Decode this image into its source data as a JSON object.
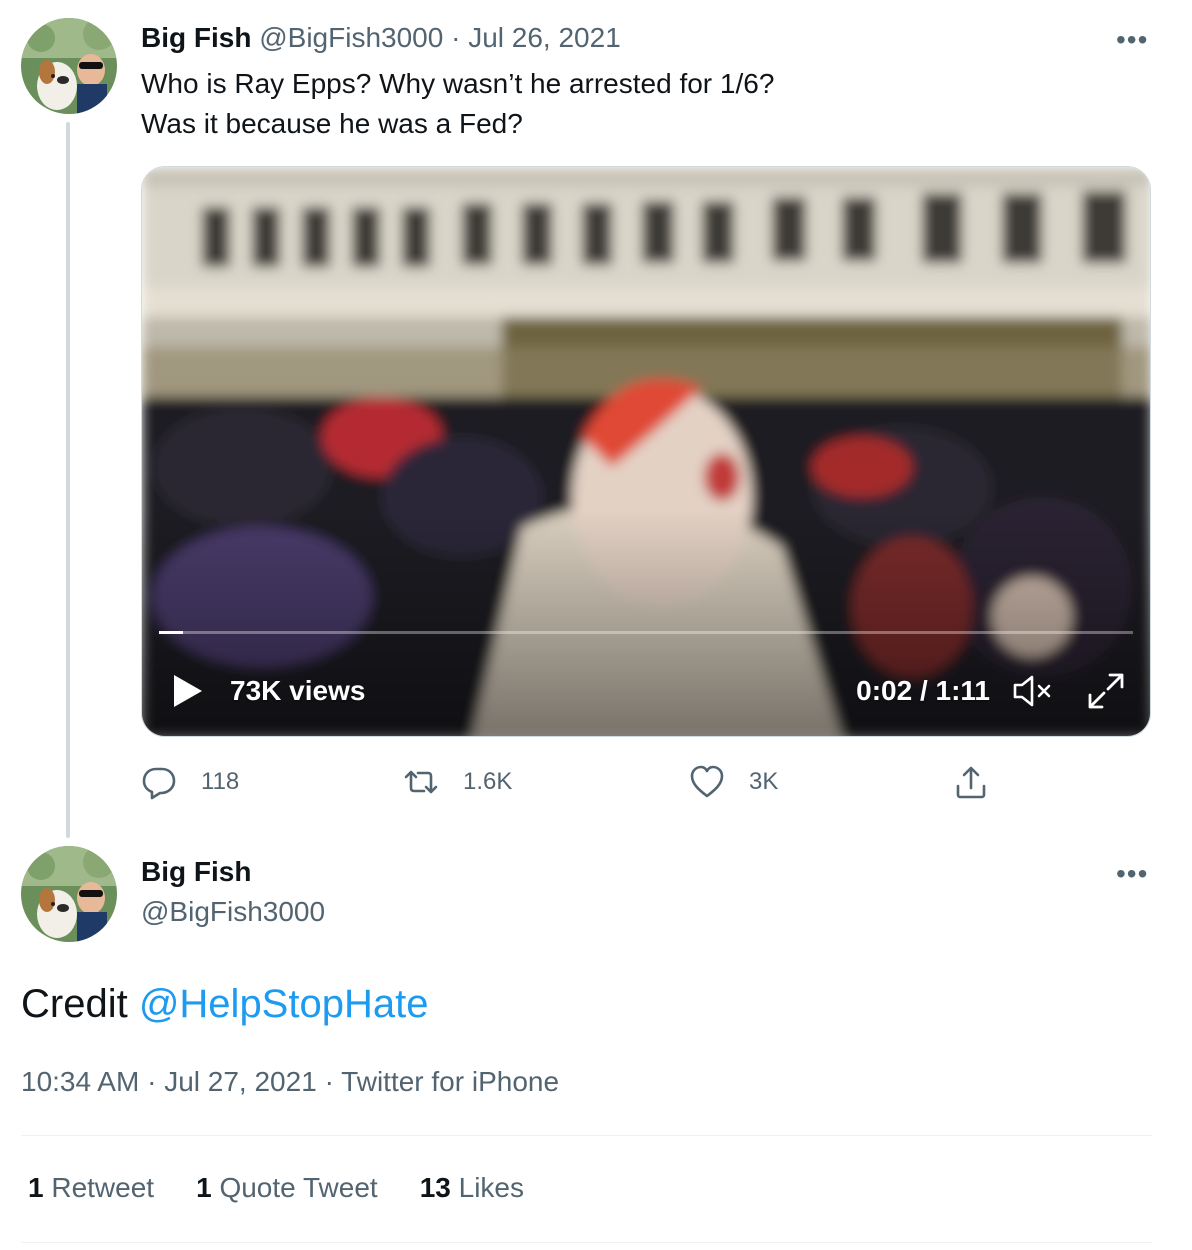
{
  "thread": {
    "tweet1": {
      "display_name": "Big Fish",
      "handle": "@BigFish3000",
      "separator": "·",
      "date": "Jul 26, 2021",
      "text_line1": "Who is Ray Epps? Why wasn’t he arrested for 1/6?",
      "text_line2": "Was it because he was a Fed?",
      "more_icon": "more-horizontal-icon",
      "video": {
        "views": "73K views",
        "timecode": "0:02 / 1:11",
        "progress": 0.025,
        "icons": [
          "play-icon",
          "mute-icon",
          "fullscreen-icon"
        ]
      },
      "actions": {
        "reply_count": "118",
        "retweet_count": "1.6K",
        "like_count": "3K"
      }
    },
    "tweet2": {
      "display_name": "Big Fish",
      "handle": "@BigFish3000",
      "text_prefix": "Credit ",
      "mention": "@HelpStopHate",
      "time": "10:34 AM",
      "separator": "·",
      "date": "Jul 27, 2021",
      "source": "Twitter for iPhone",
      "stats": {
        "retweets_count": "1",
        "retweets_label": "Retweet",
        "quotes_count": "1",
        "quotes_label": "Quote Tweet",
        "likes_count": "13",
        "likes_label": "Likes"
      }
    }
  },
  "colors": {
    "link": "#1d9bf0",
    "muted": "#536471",
    "text": "#0f1419",
    "thread_line": "#cfd9de"
  }
}
